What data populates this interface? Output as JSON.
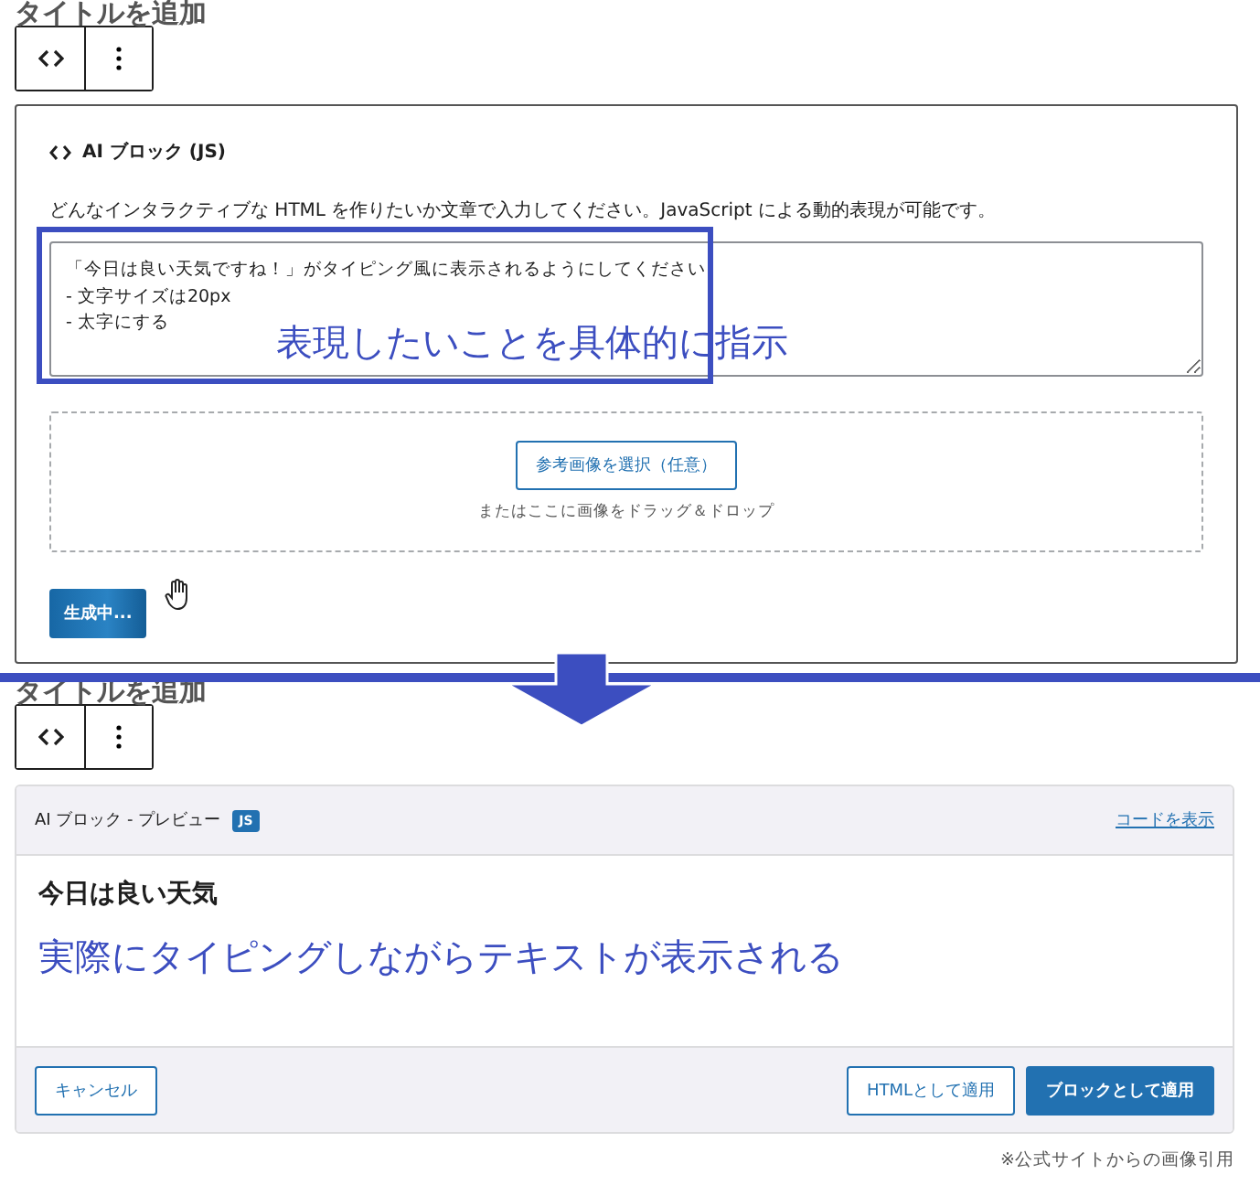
{
  "upper": {
    "title": "タイトルを追加",
    "block": {
      "heading": "AI ブロック (JS)",
      "description": "どんなインタラクティブな HTML を作りたいか文章で入力してください。JavaScript による動的表現が可能です。",
      "prompt": {
        "value": "「今日は良い天気ですね！」がタイピング風に表示されるようにしてください\n- 文字サイズは20px\n- 太字にする"
      },
      "annotation": "表現したいことを具体的に指示",
      "dropzone": {
        "button": "参考画像を選択（任意）",
        "hint": "またはここに画像をドラッグ＆ドロップ"
      },
      "generate_button": "生成中..."
    }
  },
  "lower": {
    "title": "タイトルを追加",
    "preview": {
      "heading": "AI ブロック - プレビュー",
      "badge": "JS",
      "link": "コードを表示",
      "output": "今日は良い天気",
      "annotation": "実際にタイピングしながらテキストが表示される",
      "buttons": [
        {
          "label": "キャンセル",
          "kind": "secondary"
        },
        {
          "label": "HTMLとして適用",
          "kind": "secondary"
        },
        {
          "label": "ブロックとして適用",
          "kind": "primary"
        }
      ]
    }
  },
  "footnote": "※公式サイトからの画像引用"
}
